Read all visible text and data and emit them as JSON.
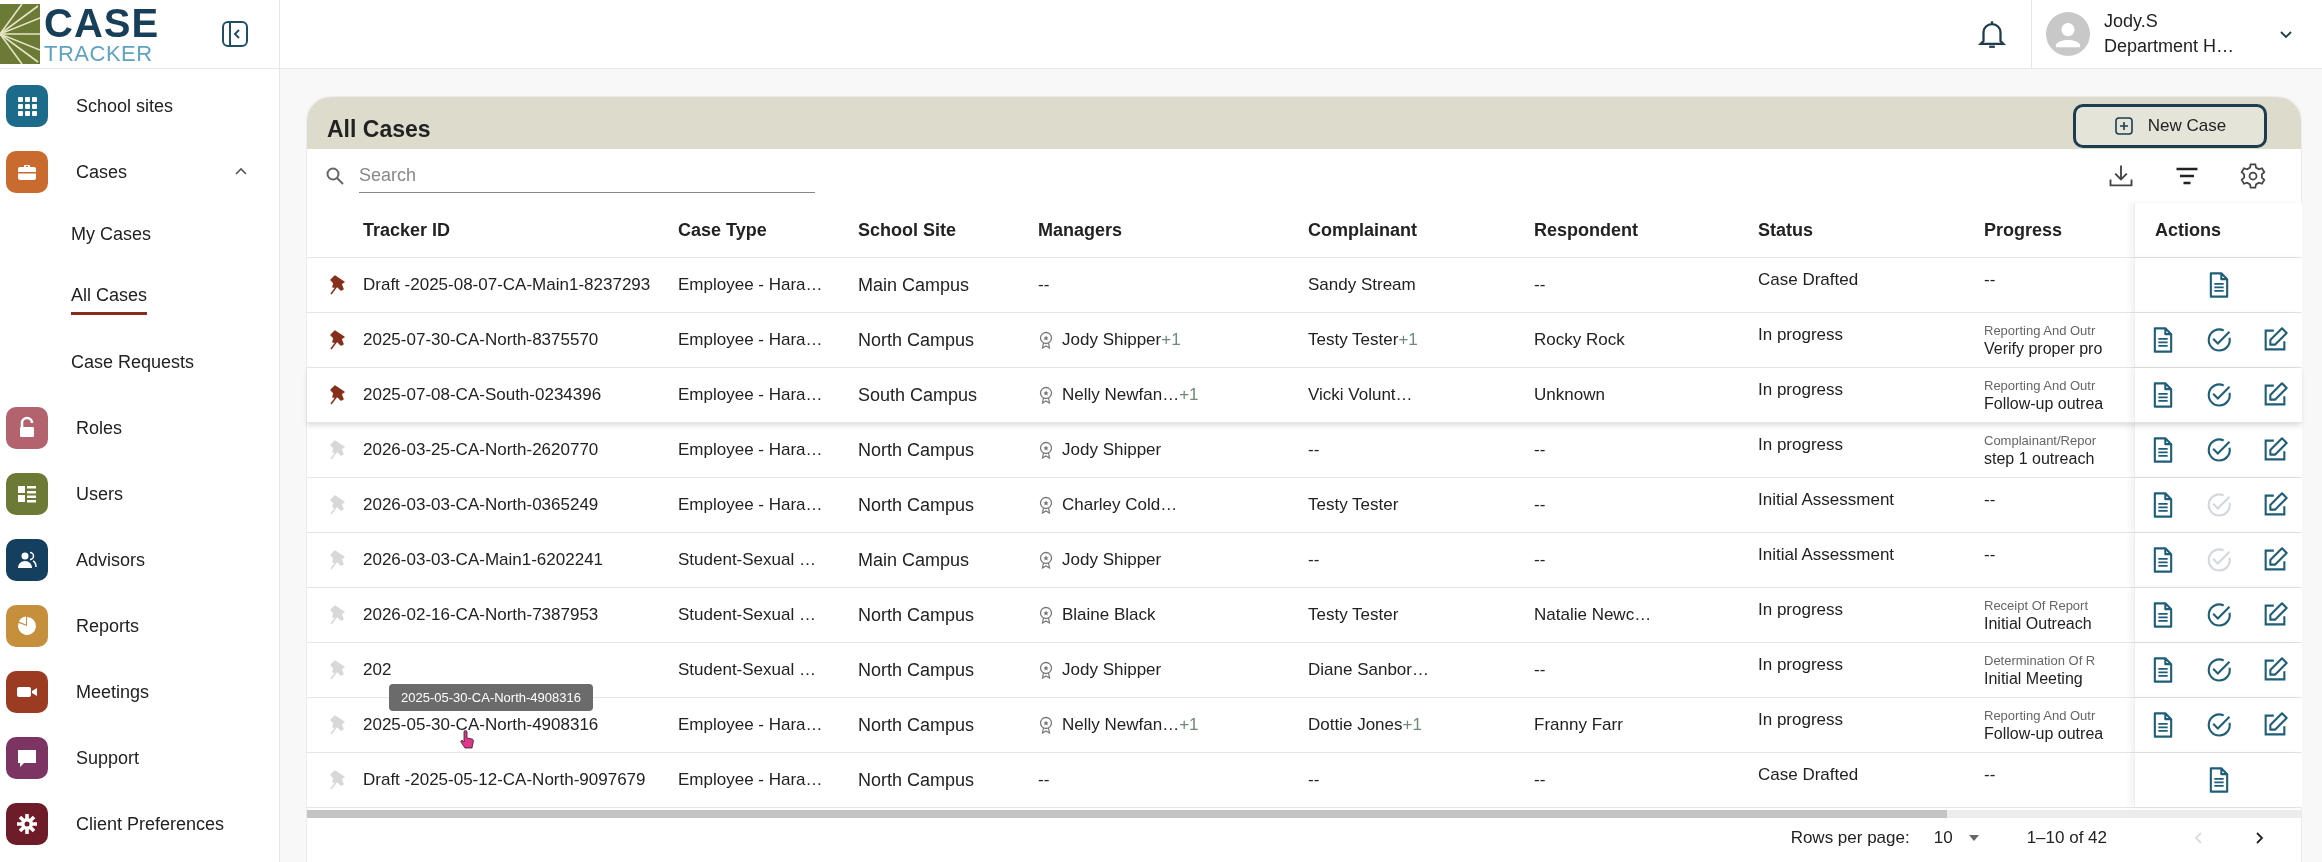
{
  "logo": {
    "line1": "CASE",
    "line2": "TRACKER"
  },
  "user": {
    "name": "Jody.S",
    "role": "Department H…"
  },
  "sidebar": {
    "items": [
      {
        "label": "School sites",
        "color": "#1d6b8a"
      },
      {
        "label": "Cases",
        "color": "#c96a2f",
        "expanded": true,
        "children": [
          {
            "label": "My Cases",
            "selected": false
          },
          {
            "label": "All Cases",
            "selected": true
          },
          {
            "label": "Case Requests",
            "selected": false
          }
        ]
      },
      {
        "label": "Roles",
        "color": "#b2636e"
      },
      {
        "label": "Users",
        "color": "#6c7a36"
      },
      {
        "label": "Advisors",
        "color": "#143f5e"
      },
      {
        "label": "Reports",
        "color": "#c58f3b"
      },
      {
        "label": "Meetings",
        "color": "#9b3c22"
      },
      {
        "label": "Support",
        "color": "#7c3562"
      },
      {
        "label": "Client Preferences",
        "color": "#6f1c2a"
      }
    ]
  },
  "page": {
    "title": "All Cases",
    "new_button": "New Case",
    "search": {
      "placeholder": "Search"
    }
  },
  "table": {
    "columns": [
      "Tracker ID",
      "Case Type",
      "School Site",
      "Managers",
      "Complainant",
      "Respondent",
      "Status",
      "Progress",
      "Actions"
    ],
    "rows": [
      {
        "pinned": true,
        "tracker_id": "Draft -2025-08-07-CA-Main1-8237293",
        "case_type": "Employee - Hara…",
        "site": "Main Campus",
        "manager": {
          "kind": "none",
          "name": "--"
        },
        "complainant": {
          "name": "Sandy Stream"
        },
        "respondent": "--",
        "status": "Case Drafted",
        "progress": {
          "kind": "none",
          "text": "--"
        },
        "actions": {
          "kind": "view_only"
        }
      },
      {
        "pinned": true,
        "tracker_id": "2025-07-30-CA-North-8375570",
        "case_type": "Employee - Hara…",
        "site": "North Campus",
        "manager": {
          "kind": "person",
          "name": "Jody Shipper",
          "extra": "+1"
        },
        "complainant": {
          "name": "Testy Tester",
          "extra": "+1"
        },
        "respondent": "Rocky Rock",
        "status": "In progress",
        "progress": {
          "kind": "step",
          "stage": "Reporting And Outr",
          "step": "Verify proper pro"
        },
        "actions": {
          "kind": "full",
          "check_disabled": false
        }
      },
      {
        "pinned": true,
        "tracker_id": "2025-07-08-CA-South-0234396",
        "case_type": "Employee - Hara…",
        "site": "South Campus",
        "manager": {
          "kind": "person",
          "name": "Nelly Newfan…",
          "extra": "+1"
        },
        "complainant": {
          "name": "Vicki Volunt…"
        },
        "respondent": "Unknown",
        "status": "In progress",
        "progress": {
          "kind": "step",
          "stage": "Reporting And Outr",
          "step": "Follow-up outrea"
        },
        "actions": {
          "kind": "full",
          "check_disabled": false
        }
      },
      {
        "pinned": false,
        "tracker_id": "2026-03-25-CA-North-2620770",
        "case_type": "Employee - Hara…",
        "site": "North Campus",
        "manager": {
          "kind": "person",
          "name": "Jody Shipper"
        },
        "complainant": {
          "name": "--"
        },
        "respondent": "--",
        "status": "In progress",
        "progress": {
          "kind": "step",
          "stage": "Complainant/Repor",
          "step": "step 1 outreach"
        },
        "actions": {
          "kind": "full",
          "check_disabled": false
        }
      },
      {
        "pinned": false,
        "tracker_id": "2026-03-03-CA-North-0365249",
        "case_type": "Employee - Hara…",
        "site": "North Campus",
        "manager": {
          "kind": "person",
          "name": "Charley Cold…"
        },
        "complainant": {
          "name": "Testy Tester"
        },
        "respondent": "--",
        "status": "Initial Assessment",
        "progress": {
          "kind": "none",
          "text": "--"
        },
        "actions": {
          "kind": "full",
          "check_disabled": true
        }
      },
      {
        "pinned": false,
        "tracker_id": "2026-03-03-CA-Main1-6202241",
        "case_type": "Student-Sexual …",
        "site": "Main Campus",
        "manager": {
          "kind": "person",
          "name": "Jody Shipper"
        },
        "complainant": {
          "name": "--"
        },
        "respondent": "--",
        "status": "Initial Assessment",
        "progress": {
          "kind": "none",
          "text": "--"
        },
        "actions": {
          "kind": "full",
          "check_disabled": true
        }
      },
      {
        "pinned": false,
        "tracker_id": "2026-02-16-CA-North-7387953",
        "case_type": "Student-Sexual …",
        "site": "North Campus",
        "manager": {
          "kind": "person",
          "name": "Blaine Black"
        },
        "complainant": {
          "name": "Testy Tester"
        },
        "respondent": "Natalie Newc…",
        "status": "In progress",
        "progress": {
          "kind": "step",
          "stage": "Receipt Of Report",
          "step": "Initial Outreach"
        },
        "actions": {
          "kind": "full",
          "check_disabled": false
        }
      },
      {
        "pinned": false,
        "tracker_id": "202",
        "case_type": "Student-Sexual …",
        "site": "North Campus",
        "manager": {
          "kind": "person",
          "name": "Jody Shipper"
        },
        "complainant": {
          "name": "Diane Sanbor…"
        },
        "respondent": "--",
        "status": "In progress",
        "progress": {
          "kind": "step",
          "stage": "Determination Of R",
          "step": "Initial Meeting"
        },
        "actions": {
          "kind": "full",
          "check_disabled": false
        }
      },
      {
        "pinned": false,
        "tracker_id": "2025-05-30-CA-North-4908316",
        "tooltip": "2025-05-30-CA-North-4908316",
        "case_type": "Employee - Hara…",
        "site": "North Campus",
        "manager": {
          "kind": "person",
          "name": "Nelly Newfan…",
          "extra": "+1"
        },
        "complainant": {
          "name": "Dottie Jones",
          "extra": "+1"
        },
        "respondent": "Franny Farr",
        "status": "In progress",
        "progress": {
          "kind": "step",
          "stage": "Reporting And Outr",
          "step": "Follow-up outrea"
        },
        "actions": {
          "kind": "full",
          "check_disabled": false
        }
      },
      {
        "pinned": false,
        "tracker_id": "Draft -2025-05-12-CA-North-9097679",
        "case_type": "Employee - Hara…",
        "site": "North Campus",
        "manager": {
          "kind": "none",
          "name": "--"
        },
        "complainant": {
          "name": "--"
        },
        "respondent": "--",
        "status": "Case Drafted",
        "progress": {
          "kind": "none",
          "text": "--"
        },
        "actions": {
          "kind": "view_only"
        }
      }
    ]
  },
  "pagination": {
    "label": "Rows per page:",
    "rows_per_page": "10",
    "range": "1–10 of 42",
    "prev_disabled": true
  }
}
